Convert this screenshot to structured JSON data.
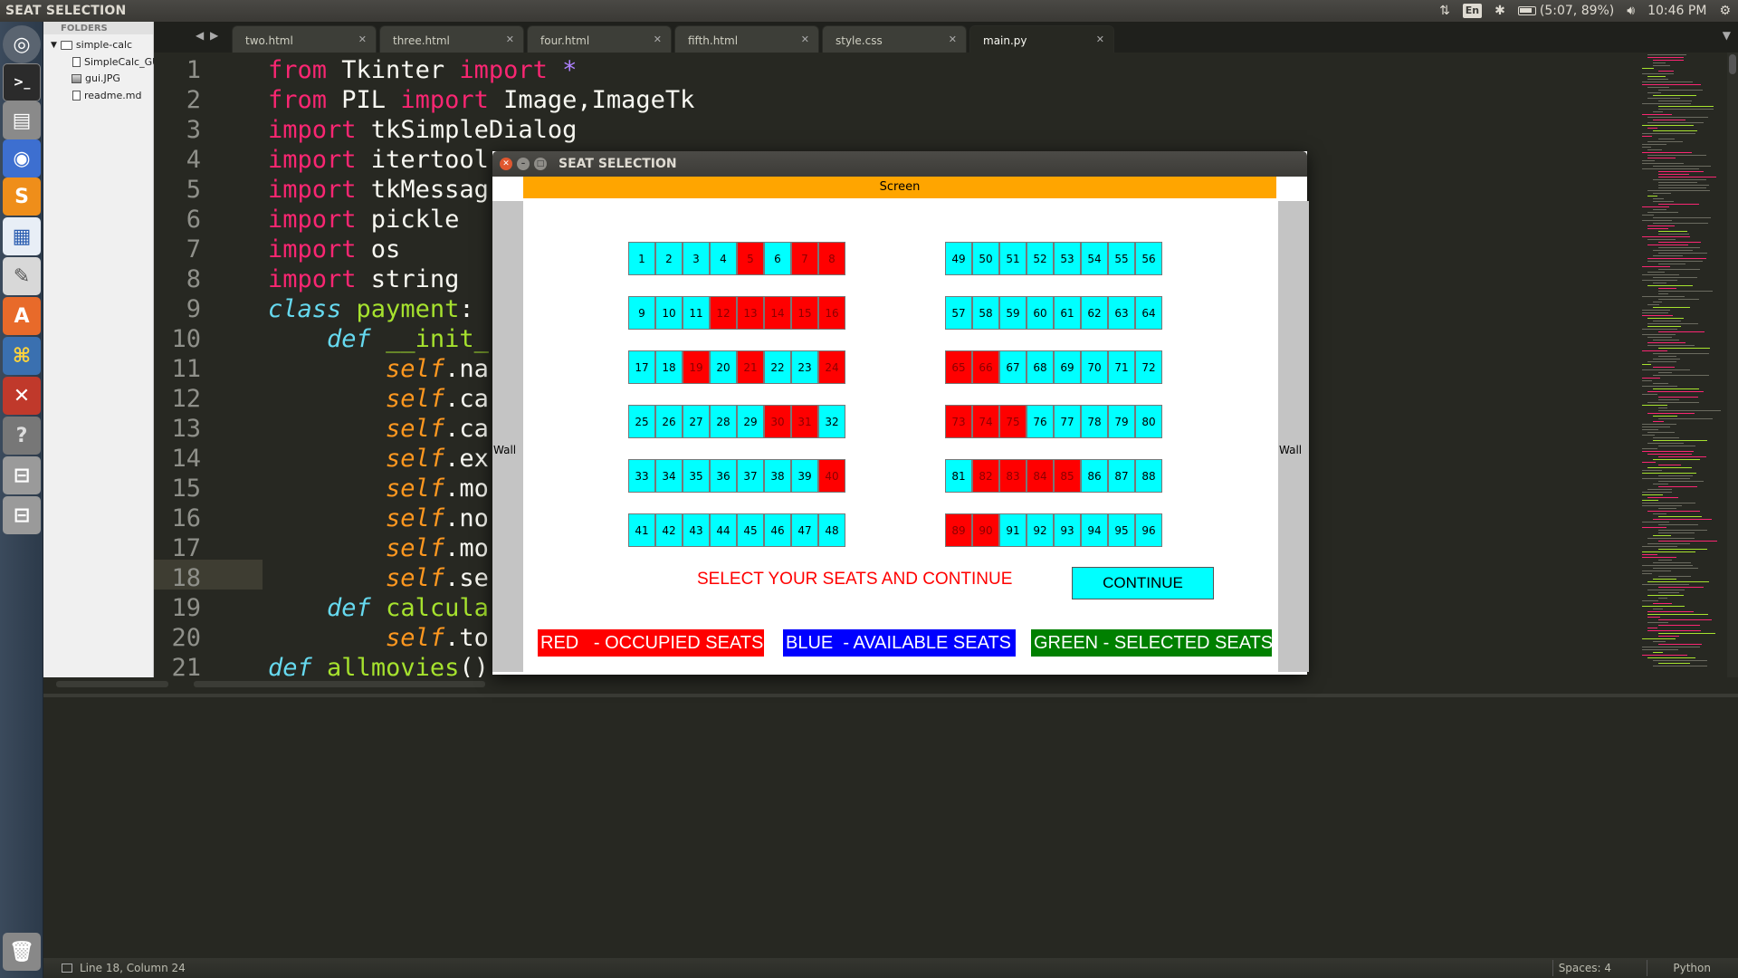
{
  "top_panel": {
    "title": "SEAT SELECTION",
    "language": "En",
    "battery": "(5:07, 89%)",
    "clock": "10:46 PM"
  },
  "sidebar": {
    "header": "FOLDERS",
    "root": "simple-calc",
    "files": [
      "SimpleCalc_GUI.",
      "gui.JPG",
      "readme.md"
    ]
  },
  "tabs": [
    "two.html",
    "three.html",
    "four.html",
    "fifth.html",
    "style.css",
    "main.py"
  ],
  "active_tab": "main.py",
  "editor": {
    "line_numbers": [
      "1",
      "2",
      "3",
      "4",
      "5",
      "6",
      "7",
      "8",
      "9",
      "10",
      "11",
      "12",
      "13",
      "14",
      "15",
      "16",
      "17",
      "18",
      "19",
      "20",
      "21"
    ],
    "lines": [
      [
        {
          "t": "from",
          "c": "kw"
        },
        {
          "t": " Tkinter ",
          "c": ""
        },
        {
          "t": "import",
          "c": "kw"
        },
        {
          "t": " ",
          "c": ""
        },
        {
          "t": "*",
          "c": "pu"
        }
      ],
      [
        {
          "t": "from",
          "c": "kw"
        },
        {
          "t": " PIL ",
          "c": ""
        },
        {
          "t": "import",
          "c": "kw"
        },
        {
          "t": " Image,ImageTk",
          "c": ""
        }
      ],
      [
        {
          "t": "import",
          "c": "kw"
        },
        {
          "t": " tkSimpleDialog",
          "c": ""
        }
      ],
      [
        {
          "t": "import",
          "c": "kw"
        },
        {
          "t": " itertool",
          "c": ""
        }
      ],
      [
        {
          "t": "import",
          "c": "kw"
        },
        {
          "t": " tkMessag",
          "c": ""
        }
      ],
      [
        {
          "t": "import",
          "c": "kw"
        },
        {
          "t": " pickle",
          "c": ""
        }
      ],
      [
        {
          "t": "import",
          "c": "kw"
        },
        {
          "t": " os",
          "c": ""
        }
      ],
      [
        {
          "t": "import",
          "c": "kw"
        },
        {
          "t": " string",
          "c": ""
        }
      ],
      [
        {
          "t": "class",
          "c": "it"
        },
        {
          "t": " ",
          "c": ""
        },
        {
          "t": "payment",
          "c": "gr"
        },
        {
          "t": ":",
          "c": ""
        }
      ],
      [
        {
          "t": "    ",
          "c": ""
        },
        {
          "t": "def",
          "c": "it"
        },
        {
          "t": " ",
          "c": ""
        },
        {
          "t": "__init_",
          "c": "gr"
        }
      ],
      [
        {
          "t": "        ",
          "c": ""
        },
        {
          "t": "self",
          "c": "sf"
        },
        {
          "t": ".na",
          "c": ""
        }
      ],
      [
        {
          "t": "        ",
          "c": ""
        },
        {
          "t": "self",
          "c": "sf"
        },
        {
          "t": ".ca",
          "c": ""
        }
      ],
      [
        {
          "t": "        ",
          "c": ""
        },
        {
          "t": "self",
          "c": "sf"
        },
        {
          "t": ".ca",
          "c": ""
        }
      ],
      [
        {
          "t": "        ",
          "c": ""
        },
        {
          "t": "self",
          "c": "sf"
        },
        {
          "t": ".ex",
          "c": ""
        }
      ],
      [
        {
          "t": "        ",
          "c": ""
        },
        {
          "t": "self",
          "c": "sf"
        },
        {
          "t": ".mo",
          "c": ""
        }
      ],
      [
        {
          "t": "        ",
          "c": ""
        },
        {
          "t": "self",
          "c": "sf"
        },
        {
          "t": ".no",
          "c": ""
        }
      ],
      [
        {
          "t": "        ",
          "c": ""
        },
        {
          "t": "self",
          "c": "sf"
        },
        {
          "t": ".mo",
          "c": ""
        }
      ],
      [
        {
          "t": "        ",
          "c": ""
        },
        {
          "t": "self",
          "c": "sf"
        },
        {
          "t": ".se",
          "c": ""
        }
      ],
      [
        {
          "t": "    ",
          "c": ""
        },
        {
          "t": "def",
          "c": "it"
        },
        {
          "t": " ",
          "c": ""
        },
        {
          "t": "calcula",
          "c": "gr"
        }
      ],
      [
        {
          "t": "        ",
          "c": ""
        },
        {
          "t": "self",
          "c": "sf"
        },
        {
          "t": ".to",
          "c": ""
        }
      ],
      [
        {
          "t": "def",
          "c": "it"
        },
        {
          "t": " ",
          "c": ""
        },
        {
          "t": "allmovies",
          "c": "gr"
        },
        {
          "t": "()",
          "c": ""
        }
      ]
    ]
  },
  "status_bar": {
    "position": "Line 18, Column 24",
    "spaces": "Spaces: 4",
    "syntax": "Python"
  },
  "dialog": {
    "title": "SEAT SELECTION",
    "screen_label": "Screen",
    "wall_left": "Wall",
    "wall_right": "Wall",
    "instruction": "SELECT YOUR SEATS AND CONTINUE",
    "continue_label": "CONTINUE",
    "occupied_seats": [
      5,
      7,
      8,
      12,
      13,
      14,
      15,
      16,
      19,
      21,
      24,
      30,
      31,
      40,
      65,
      66,
      73,
      74,
      75,
      82,
      83,
      84,
      85,
      89,
      90
    ],
    "legend": [
      {
        "label": "RED   - OCCUPIED SEATS",
        "bg": "#ff0000",
        "fg": "#ffffff"
      },
      {
        "label": "BLUE  - AVAILABLE SEATS",
        "bg": "#0000ff",
        "fg": "#ffffff"
      },
      {
        "label": "GREEN - SELECTED SEATS",
        "bg": "#008000",
        "fg": "#ffffff"
      }
    ],
    "colors": {
      "available": "#00ffff",
      "occupied": "#ff0000",
      "screen": "#ffa500"
    }
  }
}
